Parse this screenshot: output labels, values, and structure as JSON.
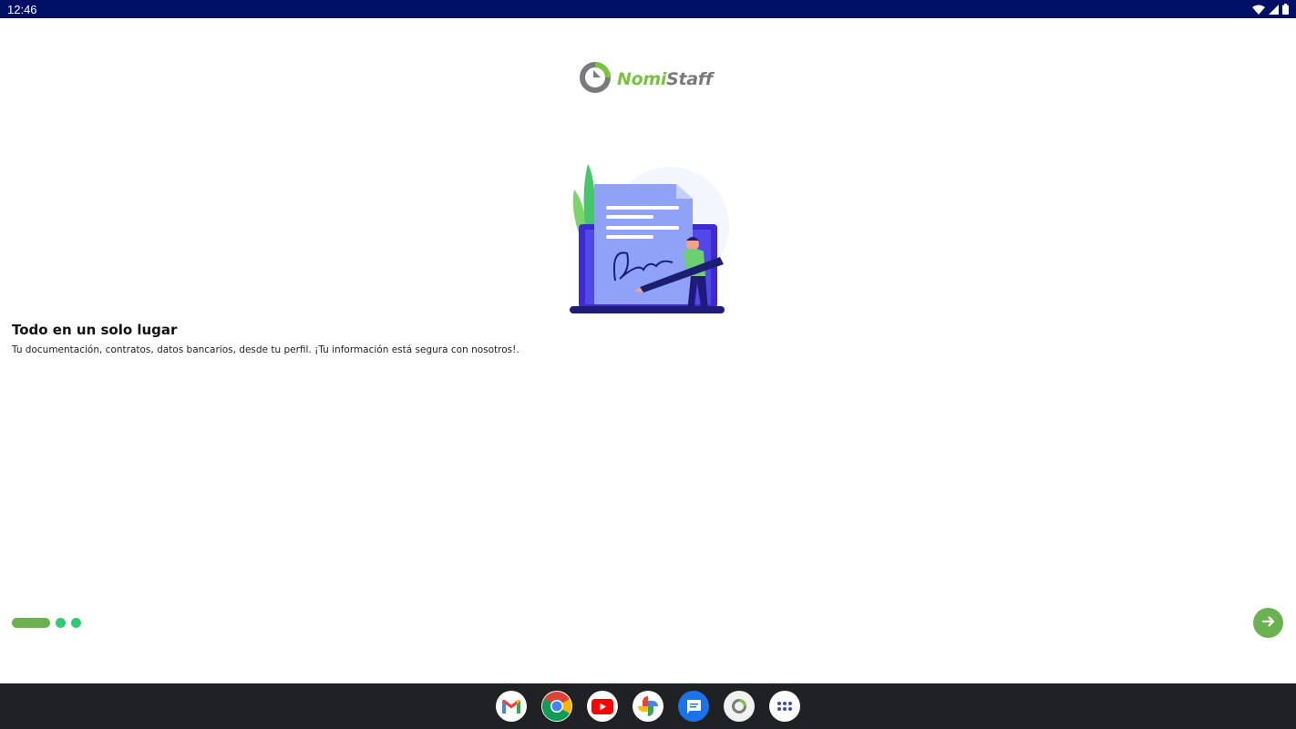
{
  "status_bar": {
    "time": "12:46",
    "icons": [
      "wifi-icon",
      "signal-icon",
      "battery-icon"
    ]
  },
  "app": {
    "logo": {
      "text_part1": "Nomi",
      "text_part2": "Staff"
    },
    "slide": {
      "title": "Todo en un solo lugar",
      "description": "Tu documentación, contratos, datos bancarios, desde tu perfil. ¡Tu información está segura con nosotros!."
    },
    "pager": {
      "total": 3,
      "current": 1
    },
    "next_button_icon": "arrow-right-icon"
  },
  "taskbar": {
    "apps": [
      "gmail-icon",
      "chrome-icon",
      "youtube-icon",
      "photos-icon",
      "messages-icon",
      "nomistaff-icon",
      "app-drawer-icon"
    ]
  },
  "colors": {
    "status_bar": "#000f66",
    "accent_green": "#6ab150",
    "dot_green": "#2ecc71",
    "taskbar": "#202124"
  }
}
